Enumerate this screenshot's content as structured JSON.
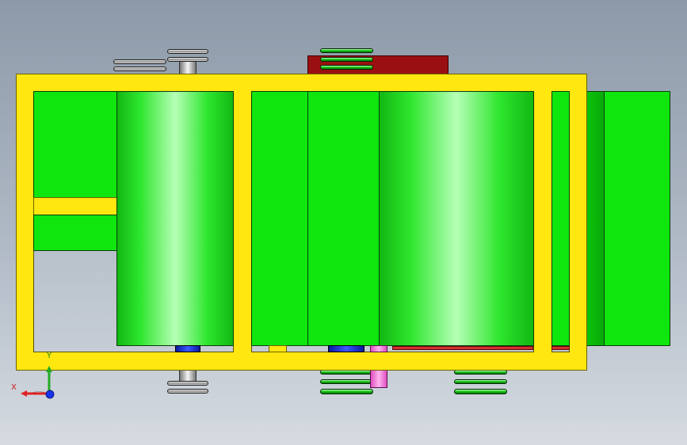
{
  "view": {
    "background_top": "#8c99a8",
    "background_bottom": "#d6dbe1"
  },
  "colors": {
    "frame": "#ffe70f",
    "green_part": "#0ee60e",
    "red_plate": "#9a1010",
    "blue_part": "#2038e0",
    "pink_part": "#ff8ce6"
  },
  "triad": {
    "x_label": "X",
    "y_label": "Y"
  }
}
